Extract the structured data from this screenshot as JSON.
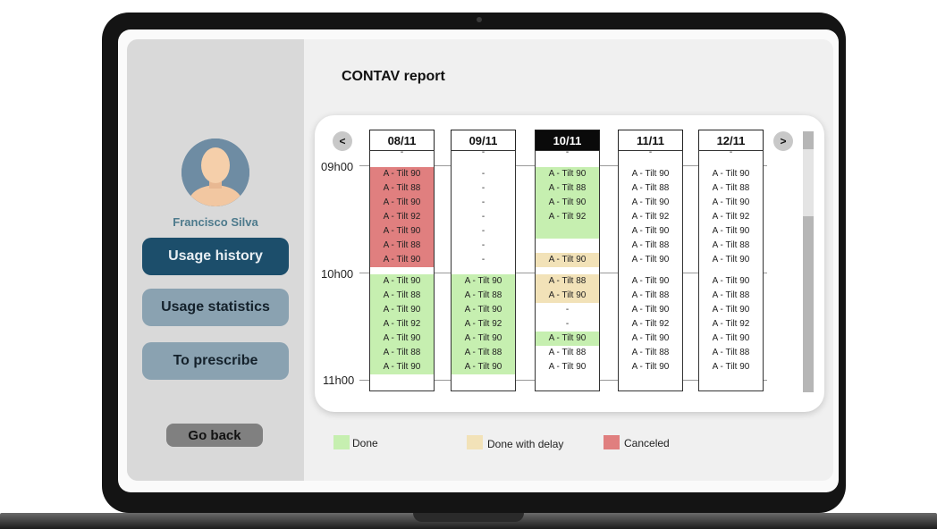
{
  "sidebar": {
    "user_name": "Francisco Silva",
    "nav": [
      {
        "label": "Usage history",
        "active": true
      },
      {
        "label": "Usage statistics",
        "active": false
      },
      {
        "label": "To prescribe",
        "active": false
      }
    ],
    "go_back": "Go back"
  },
  "report": {
    "title": "CONTAV report",
    "prev": "<",
    "next": ">",
    "times": [
      "09h00",
      "10h00",
      "11h00"
    ],
    "days": [
      {
        "date": "08/11",
        "today": false,
        "hour1": {
          "align": "top",
          "items": [
            {
              "label": "A - Tilt 90",
              "status": "canceled"
            },
            {
              "label": "A - Tilt 88",
              "status": "canceled"
            },
            {
              "label": "A - Tilt 90",
              "status": "canceled"
            },
            {
              "label": "A - Tilt 92",
              "status": "canceled"
            },
            {
              "label": "A - Tilt 90",
              "status": "canceled"
            },
            {
              "label": "A - Tilt 88",
              "status": "canceled"
            },
            {
              "label": "A - Tilt 90",
              "status": "canceled"
            }
          ]
        },
        "hour2": {
          "align": "top",
          "items": [
            {
              "label": "A - Tilt 90",
              "status": "done"
            },
            {
              "label": "A - Tilt 88",
              "status": "done"
            },
            {
              "label": "A - Tilt 90",
              "status": "done"
            },
            {
              "label": "A - Tilt 92",
              "status": "done"
            },
            {
              "label": "A - Tilt 90",
              "status": "done"
            },
            {
              "label": "A - Tilt 88",
              "status": "done"
            },
            {
              "label": "A - Tilt 90",
              "status": "done"
            }
          ]
        }
      },
      {
        "date": "09/11",
        "today": false,
        "hour1": {
          "align": "top",
          "items": [
            {
              "label": "-",
              "status": "none"
            },
            {
              "label": "-",
              "status": "none"
            },
            {
              "label": "-",
              "status": "none"
            },
            {
              "label": "-",
              "status": "none"
            },
            {
              "label": "-",
              "status": "none"
            },
            {
              "label": "-",
              "status": "none"
            },
            {
              "label": "-",
              "status": "none"
            }
          ]
        },
        "hour2": {
          "align": "top",
          "items": [
            {
              "label": "A - Tilt 90",
              "status": "done"
            },
            {
              "label": "A - Tilt 88",
              "status": "done"
            },
            {
              "label": "A - Tilt 90",
              "status": "done"
            },
            {
              "label": "A - Tilt 92",
              "status": "done"
            },
            {
              "label": "A - Tilt 90",
              "status": "done"
            },
            {
              "label": "A - Tilt 88",
              "status": "done"
            },
            {
              "label": "A - Tilt 90",
              "status": "done"
            }
          ]
        }
      },
      {
        "date": "10/11",
        "today": true,
        "hour1": {
          "align": "top",
          "items": [
            {
              "label": "A - Tilt 90",
              "status": "done"
            },
            {
              "label": "A - Tilt 88",
              "status": "done"
            },
            {
              "label": "A - Tilt 90",
              "status": "done"
            },
            {
              "label": "A - Tilt 92",
              "status": "done"
            },
            {
              "label": "",
              "status": "done"
            },
            {
              "label": "",
              "status": "none"
            },
            {
              "label": "A - Tilt 90",
              "status": "delay"
            }
          ]
        },
        "hour2": {
          "align": "top",
          "items": [
            {
              "label": "A - Tilt 88",
              "status": "delay"
            },
            {
              "label": "A - Tilt 90",
              "status": "delay"
            },
            {
              "label": "-",
              "status": "none"
            },
            {
              "label": "-",
              "status": "none"
            },
            {
              "label": "A - Tilt 90",
              "status": "done"
            },
            {
              "label": "A - Tilt 88",
              "status": "none"
            },
            {
              "label": "A - Tilt 90",
              "status": "none"
            }
          ]
        }
      },
      {
        "date": "11/11",
        "today": false,
        "hour1": {
          "align": "top",
          "items": [
            {
              "label": "A - Tilt 90",
              "status": "none"
            },
            {
              "label": "A - Tilt 88",
              "status": "none"
            },
            {
              "label": "A - Tilt 90",
              "status": "none"
            },
            {
              "label": "A - Tilt 92",
              "status": "none"
            },
            {
              "label": "A - Tilt 90",
              "status": "none"
            },
            {
              "label": "A - Tilt 88",
              "status": "none"
            },
            {
              "label": "A - Tilt 90",
              "status": "none"
            }
          ]
        },
        "hour2": {
          "align": "top",
          "items": [
            {
              "label": "A - Tilt 90",
              "status": "none"
            },
            {
              "label": "A - Tilt 88",
              "status": "none"
            },
            {
              "label": "A - Tilt 90",
              "status": "none"
            },
            {
              "label": "A - Tilt 92",
              "status": "none"
            },
            {
              "label": "A - Tilt 90",
              "status": "none"
            },
            {
              "label": "A - Tilt 88",
              "status": "none"
            },
            {
              "label": "A - Tilt 90",
              "status": "none"
            }
          ]
        }
      },
      {
        "date": "12/11",
        "today": false,
        "hour1": {
          "align": "top",
          "items": [
            {
              "label": "A - Tilt 90",
              "status": "none"
            },
            {
              "label": "A - Tilt 88",
              "status": "none"
            },
            {
              "label": "A - Tilt 90",
              "status": "none"
            },
            {
              "label": "A - Tilt 92",
              "status": "none"
            },
            {
              "label": "A - Tilt 90",
              "status": "none"
            },
            {
              "label": "A - Tilt 88",
              "status": "none"
            },
            {
              "label": "A - Tilt 90",
              "status": "none"
            }
          ]
        },
        "hour2": {
          "align": "top",
          "items": [
            {
              "label": "A - Tilt 90",
              "status": "none"
            },
            {
              "label": "A - Tilt 88",
              "status": "none"
            },
            {
              "label": "A - Tilt 90",
              "status": "none"
            },
            {
              "label": "A - Tilt 92",
              "status": "none"
            },
            {
              "label": "A - Tilt 90",
              "status": "none"
            },
            {
              "label": "A - Tilt 88",
              "status": "none"
            },
            {
              "label": "A - Tilt 90",
              "status": "none"
            }
          ]
        }
      }
    ]
  },
  "legend": [
    {
      "label": "Done",
      "status": "done"
    },
    {
      "label": "Done with delay",
      "status": "delay"
    },
    {
      "label": "Canceled",
      "status": "canceled"
    }
  ],
  "colors": {
    "done": "#c6efb0",
    "delay": "#f2e2b8",
    "canceled": "#e07f7f",
    "none": "#ffffff",
    "accent": "#1c4e6b"
  }
}
